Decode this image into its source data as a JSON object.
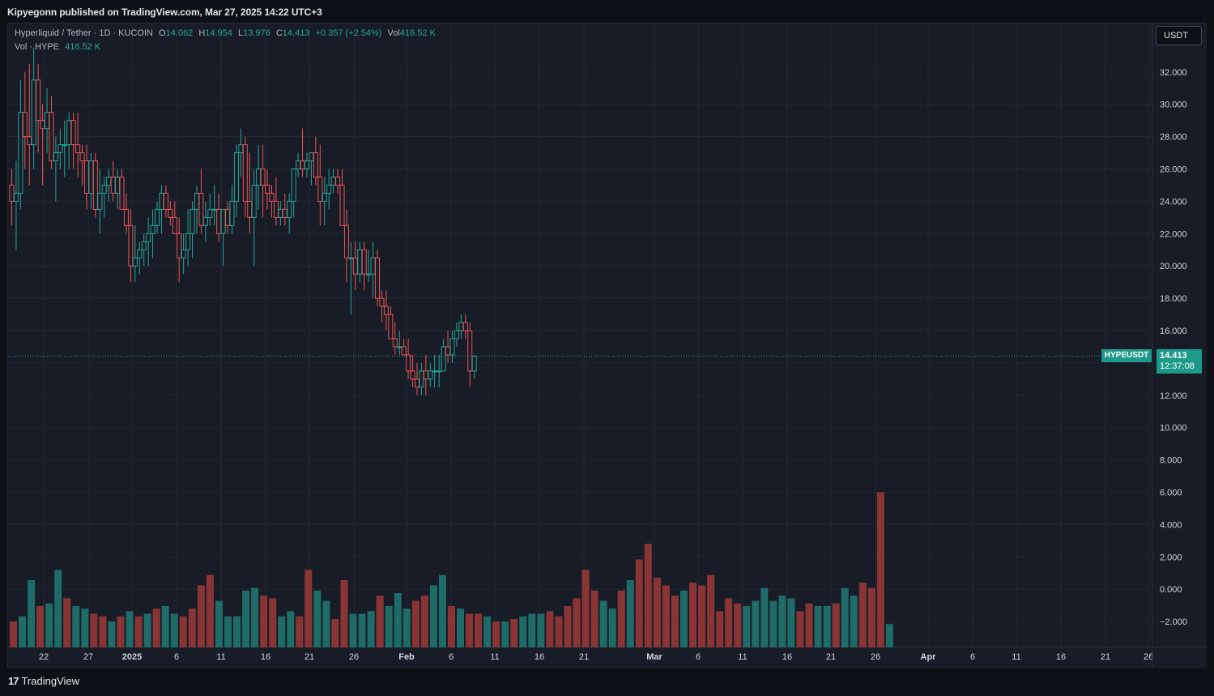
{
  "publisher_line": "Kipyegonn published on TradingView.com, Mar 27, 2025 14:22 UTC+3",
  "legend": {
    "symbol": "Hyperliquid / Tether · 1D · KUCOIN",
    "open_label": "O",
    "open": "14.062",
    "high_label": "H",
    "high": "14.954",
    "low_label": "L",
    "low": "13.976",
    "close_label": "C",
    "close": "14.413",
    "change": "+0.357 (+2.54%)",
    "vol_label": "Vol",
    "vol": "416.52 K",
    "vol_series_label": "Vol · HYPE",
    "vol_series_value": "416.52 K"
  },
  "unit_button": "USDT",
  "last_price": {
    "symbol": "HYPEUSDT",
    "price": "14.413",
    "countdown": "12:37:08"
  },
  "footer": {
    "brand": "TradingView",
    "logo": "17"
  },
  "colors": {
    "up": "#26a69a",
    "down": "#ef5350",
    "up_vol": "#1e6b67",
    "down_vol": "#8a3535",
    "background": "#181c27",
    "grid": "#232735"
  },
  "chart_data": {
    "type": "candlestick",
    "price_axis": {
      "ylim": [
        -3.6,
        35.0
      ],
      "ticks": [
        "32.000",
        "30.000",
        "28.000",
        "26.000",
        "24.000",
        "22.000",
        "20.000",
        "18.000",
        "16.000",
        "14.000",
        "12.000",
        "10.000",
        "8.000",
        "6.000",
        "4.000",
        "2.000",
        "0.000",
        "−2.000"
      ]
    },
    "time_axis": {
      "labels": [
        "22",
        "27",
        "2025",
        "6",
        "11",
        "16",
        "21",
        "26",
        "Feb",
        "6",
        "11",
        "16",
        "21",
        "Mar",
        "6",
        "11",
        "16",
        "21",
        "26",
        "Apr",
        "6",
        "11",
        "16",
        "21",
        "26"
      ]
    },
    "ohlc": [
      [
        25,
        26,
        22.5,
        24
      ],
      [
        24,
        26.5,
        21,
        24.5
      ],
      [
        24.5,
        31.5,
        23.5,
        29.5
      ],
      [
        29.5,
        32,
        26,
        28
      ],
      [
        28,
        32.5,
        25,
        27.5
      ],
      [
        27.5,
        33.5,
        26,
        31.5
      ],
      [
        31.5,
        32.5,
        27,
        29
      ],
      [
        29,
        30,
        25,
        28.5
      ],
      [
        28.5,
        31,
        27,
        29.5
      ],
      [
        29.5,
        30.5,
        26,
        26.5
      ],
      [
        26.5,
        28,
        24,
        27
      ],
      [
        27,
        28.5,
        26,
        27.5
      ],
      [
        27.5,
        29,
        25.5,
        27.5
      ],
      [
        27.5,
        29.5,
        26,
        29
      ],
      [
        29,
        29.5,
        26,
        27.5
      ],
      [
        27.5,
        29.5,
        25.5,
        27
      ],
      [
        27,
        27.5,
        25,
        26.5
      ],
      [
        26.5,
        27.5,
        23.5,
        24.5
      ],
      [
        24.5,
        27,
        23.5,
        26.5
      ],
      [
        26.5,
        27,
        23,
        23.5
      ],
      [
        23.5,
        26,
        22,
        24.5
      ],
      [
        24.5,
        25.5,
        23,
        25
      ],
      [
        25,
        26,
        24,
        25.5
      ],
      [
        25.5,
        26.5,
        24,
        24.5
      ],
      [
        24.5,
        26,
        23.5,
        25.5
      ],
      [
        25.5,
        26,
        23.5,
        23.5
      ],
      [
        23.5,
        24.5,
        22,
        22.5
      ],
      [
        22.5,
        23.5,
        19,
        20
      ],
      [
        20,
        22.5,
        19,
        20.5
      ],
      [
        20.5,
        21.5,
        19.5,
        21
      ],
      [
        21,
        22,
        20,
        21.5
      ],
      [
        21.5,
        23,
        20,
        22
      ],
      [
        22,
        23.5,
        20.5,
        22.5
      ],
      [
        22.5,
        24,
        22,
        23.5
      ],
      [
        23.5,
        25,
        22,
        24.5
      ],
      [
        24.5,
        25,
        23,
        23.5
      ],
      [
        23.5,
        24,
        22.5,
        23
      ],
      [
        23,
        24,
        22,
        22
      ],
      [
        22,
        23,
        19,
        20.5
      ],
      [
        20.5,
        22,
        19.5,
        21
      ],
      [
        21,
        23.5,
        20,
        22
      ],
      [
        22,
        24,
        20.5,
        23.5
      ],
      [
        23.5,
        25,
        22,
        24.5
      ],
      [
        24.5,
        26,
        22,
        22.5
      ],
      [
        22.5,
        24,
        21.5,
        23
      ],
      [
        23,
        24.5,
        22.5,
        23.5
      ],
      [
        23.5,
        25,
        22.5,
        23.5
      ],
      [
        23.5,
        24.5,
        21.5,
        22
      ],
      [
        22,
        23.5,
        20,
        23.5
      ],
      [
        23.5,
        24,
        22,
        22.5
      ],
      [
        22.5,
        25,
        22,
        24
      ],
      [
        24,
        27.5,
        23,
        27
      ],
      [
        27,
        28.5,
        25.5,
        27.5
      ],
      [
        27.5,
        28,
        23,
        24
      ],
      [
        24,
        27,
        22,
        23
      ],
      [
        23,
        26,
        20,
        25
      ],
      [
        25,
        27.5,
        23.5,
        26
      ],
      [
        26,
        27.5,
        23,
        25
      ],
      [
        25,
        26,
        23.5,
        24.5
      ],
      [
        24.5,
        25,
        23,
        24
      ],
      [
        24,
        25.5,
        22.5,
        23
      ],
      [
        23,
        24,
        22.5,
        23.5
      ],
      [
        23.5,
        24.5,
        22.5,
        23
      ],
      [
        23,
        24.5,
        22,
        24
      ],
      [
        24,
        26,
        23,
        26
      ],
      [
        26,
        27,
        25.5,
        26.5
      ],
      [
        26.5,
        28.5,
        25.5,
        26
      ],
      [
        26,
        27,
        25.5,
        26.5
      ],
      [
        26.5,
        27,
        25,
        27
      ],
      [
        27,
        28,
        25,
        25.5
      ],
      [
        25.5,
        27.5,
        22.5,
        24
      ],
      [
        24,
        25.5,
        22.5,
        24.5
      ],
      [
        24.5,
        26,
        23.5,
        25
      ],
      [
        25,
        26,
        24.5,
        25.5
      ],
      [
        25.5,
        26,
        24.5,
        25
      ],
      [
        25,
        26,
        23,
        22.5
      ],
      [
        22.5,
        23.5,
        19,
        20.5
      ],
      [
        20.5,
        21.5,
        17,
        20.5
      ],
      [
        20.5,
        21.5,
        18.5,
        19.5
      ],
      [
        19.5,
        21.5,
        19,
        21
      ],
      [
        21,
        21.5,
        18.5,
        19.5
      ],
      [
        19.5,
        21,
        19,
        19.5
      ],
      [
        19.5,
        21.5,
        18,
        20.5
      ],
      [
        20.5,
        21,
        17.5,
        18
      ],
      [
        18,
        18.5,
        16.5,
        17.5
      ],
      [
        17.5,
        18.5,
        16,
        17
      ],
      [
        17,
        17.5,
        15.5,
        15.5
      ],
      [
        15.5,
        16.5,
        14.5,
        15
      ],
      [
        15,
        16,
        14.5,
        15
      ],
      [
        15,
        15.5,
        14.5,
        14.5
      ],
      [
        14.5,
        15.5,
        13,
        13.5
      ],
      [
        13.5,
        14.5,
        12.5,
        13
      ],
      [
        13,
        14,
        12,
        12.5
      ],
      [
        12.5,
        14,
        12,
        13.5
      ],
      [
        13.5,
        14.5,
        12,
        13
      ],
      [
        13,
        14,
        12.5,
        13.5
      ],
      [
        13.5,
        14.5,
        12.5,
        13.5
      ],
      [
        13.5,
        14.5,
        12.5,
        13.5
      ],
      [
        13.5,
        15.5,
        13.5,
        15
      ],
      [
        15,
        16,
        14,
        14.5
      ],
      [
        14.5,
        16,
        14,
        15.5
      ],
      [
        15.5,
        16.5,
        15,
        16
      ],
      [
        16,
        17,
        15.5,
        16.5
      ],
      [
        16.5,
        17,
        15.5,
        16
      ],
      [
        16,
        16.5,
        12.5,
        13.5
      ],
      [
        13.5,
        14.5,
        13,
        14.413
      ]
    ],
    "volume": [
      [
        1,
        0
      ],
      [
        1.2,
        1
      ],
      [
        2.6,
        1
      ],
      [
        1.6,
        0
      ],
      [
        1.7,
        1
      ],
      [
        3.0,
        1
      ],
      [
        1.9,
        0
      ],
      [
        1.6,
        1
      ],
      [
        1.5,
        1
      ],
      [
        1.3,
        0
      ],
      [
        1.2,
        0
      ],
      [
        1.0,
        1
      ],
      [
        1.2,
        0
      ],
      [
        1.4,
        1
      ],
      [
        1.2,
        0
      ],
      [
        1.3,
        1
      ],
      [
        1.5,
        0
      ],
      [
        1.6,
        1
      ],
      [
        1.3,
        1
      ],
      [
        1.2,
        0
      ],
      [
        1.5,
        0
      ],
      [
        2.4,
        0
      ],
      [
        2.8,
        0
      ],
      [
        1.8,
        1
      ],
      [
        1.2,
        1
      ],
      [
        1.2,
        1
      ],
      [
        2.2,
        1
      ],
      [
        2.3,
        1
      ],
      [
        2.0,
        0
      ],
      [
        1.9,
        0
      ],
      [
        1.2,
        1
      ],
      [
        1.4,
        1
      ],
      [
        1.2,
        0
      ],
      [
        3.0,
        0
      ],
      [
        2.2,
        1
      ],
      [
        1.8,
        1
      ],
      [
        1.1,
        0
      ],
      [
        2.6,
        0
      ],
      [
        1.3,
        1
      ],
      [
        1.3,
        1
      ],
      [
        1.4,
        1
      ],
      [
        2.0,
        0
      ],
      [
        1.6,
        1
      ],
      [
        2.1,
        1
      ],
      [
        1.5,
        1
      ],
      [
        1.8,
        0
      ],
      [
        2.0,
        0
      ],
      [
        2.4,
        1
      ],
      [
        2.8,
        1
      ],
      [
        1.6,
        0
      ],
      [
        1.5,
        1
      ],
      [
        1.3,
        0
      ],
      [
        1.3,
        0
      ],
      [
        1.2,
        1
      ],
      [
        1.0,
        0
      ],
      [
        1.0,
        1
      ],
      [
        1.1,
        0
      ],
      [
        1.2,
        1
      ],
      [
        1.3,
        1
      ],
      [
        1.3,
        1
      ],
      [
        1.4,
        0
      ],
      [
        1.2,
        0
      ],
      [
        1.6,
        0
      ],
      [
        1.9,
        0
      ],
      [
        3.0,
        0
      ],
      [
        2.2,
        0
      ],
      [
        1.8,
        1
      ],
      [
        1.5,
        1
      ],
      [
        2.2,
        0
      ],
      [
        2.6,
        1
      ],
      [
        3.4,
        0
      ],
      [
        4.0,
        0
      ],
      [
        2.7,
        0
      ],
      [
        2.4,
        0
      ],
      [
        2.0,
        0
      ],
      [
        2.2,
        1
      ],
      [
        2.5,
        0
      ],
      [
        2.4,
        0
      ],
      [
        2.8,
        0
      ],
      [
        1.4,
        0
      ],
      [
        1.9,
        0
      ],
      [
        1.7,
        0
      ],
      [
        1.6,
        1
      ],
      [
        1.8,
        1
      ],
      [
        2.3,
        1
      ],
      [
        1.8,
        1
      ],
      [
        2.0,
        1
      ],
      [
        1.9,
        1
      ],
      [
        1.4,
        0
      ],
      [
        1.7,
        0
      ],
      [
        1.6,
        1
      ],
      [
        1.6,
        1
      ],
      [
        1.7,
        0
      ],
      [
        2.3,
        1
      ],
      [
        2.0,
        1
      ],
      [
        2.5,
        0
      ],
      [
        2.3,
        0
      ],
      [
        6.0,
        0
      ],
      [
        0.9,
        1
      ]
    ]
  }
}
